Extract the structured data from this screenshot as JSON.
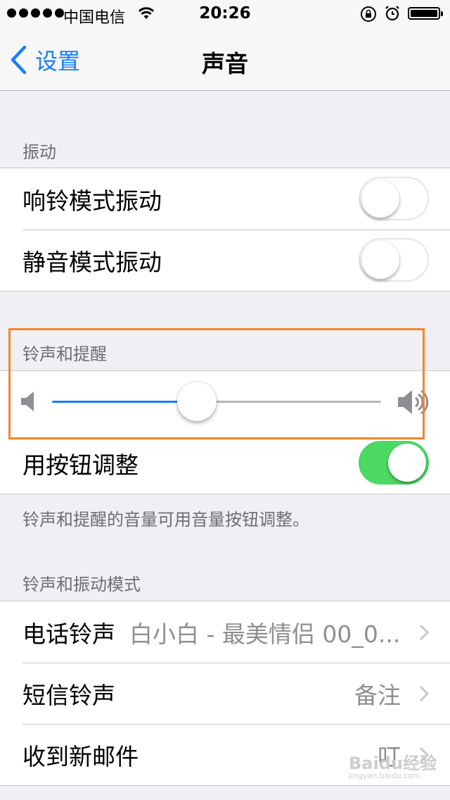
{
  "status_bar": {
    "carrier": "中国电信",
    "time": "20:26"
  },
  "nav": {
    "back_label": "设置",
    "title": "声音"
  },
  "vibrate": {
    "header": "振动",
    "items": [
      {
        "label": "响铃模式振动",
        "on": false
      },
      {
        "label": "静音模式振动",
        "on": false
      }
    ]
  },
  "ringer": {
    "header": "铃声和提醒",
    "volume_level": 0.44,
    "change_with_buttons": {
      "label": "用按钮调整",
      "on": true
    },
    "footer": "铃声和提醒的音量可用音量按钮调整。"
  },
  "patterns": {
    "header": "铃声和振动模式",
    "items": [
      {
        "label": "电话铃声",
        "value": "白小白 - 最美情侣 00_0..."
      },
      {
        "label": "短信铃声",
        "value": "备注"
      },
      {
        "label": "收到新邮件",
        "value": "叮"
      }
    ]
  },
  "watermark": {
    "text": "Baidu经验",
    "sub": "jingyan.baidu.com"
  },
  "colors": {
    "accent": "#157efb",
    "toggle_on": "#4cd964",
    "highlight": "#f5852b",
    "background": "#efeff4"
  }
}
